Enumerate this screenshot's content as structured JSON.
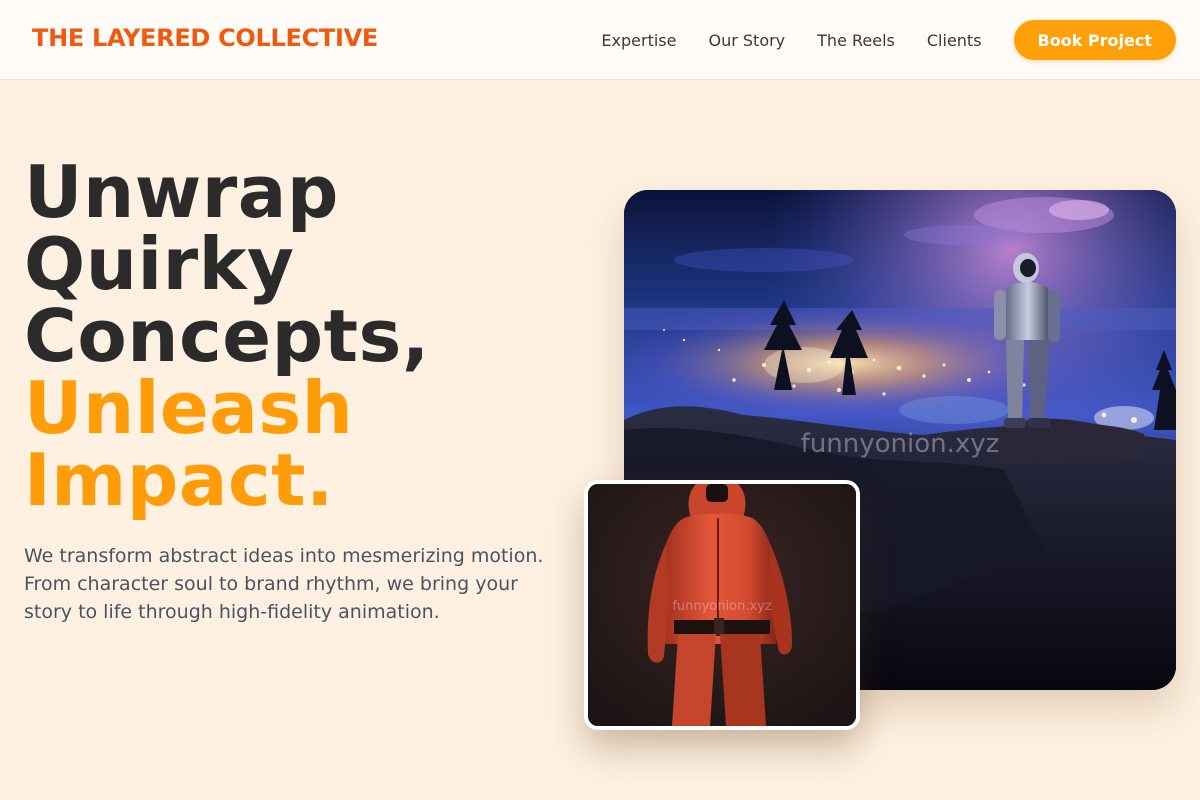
{
  "brand": {
    "name": "THE LAYERED COLLECTIVE",
    "color": "#ef5a10"
  },
  "nav": {
    "links": [
      {
        "label": "Expertise"
      },
      {
        "label": "Our Story"
      },
      {
        "label": "The Reels"
      },
      {
        "label": "Clients"
      }
    ],
    "cta_label": "Book Project",
    "cta_color": "#ff9f0a"
  },
  "hero": {
    "title_lines": [
      "Unwrap",
      "Quirky",
      "Concepts,"
    ],
    "accent_lines": [
      "Unleash",
      "Impact."
    ],
    "accent_color": "#ff9c0a",
    "description": "We transform abstract ideas into mesmerizing motion. From character soul to brand rhythm, we bring your story to life through high-fidelity animation."
  },
  "images": {
    "main": {
      "subject": "astronaut overlooking night city lights from cliff",
      "watermark": "funnyonion.xyz"
    },
    "secondary": {
      "subject": "red hooded jumpsuit character back view",
      "watermark": "funnyonion.xyz"
    }
  },
  "colors": {
    "background": "#fef1e1",
    "nav_background": "#fffcf8"
  }
}
